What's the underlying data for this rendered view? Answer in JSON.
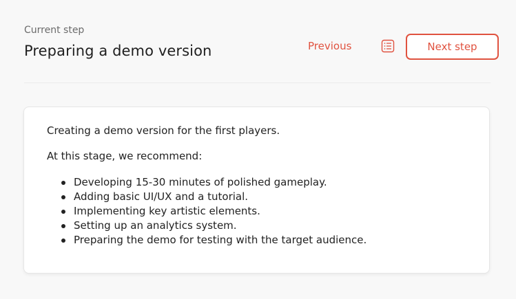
{
  "header": {
    "step_label": "Current step",
    "step_title": "Preparing a demo version",
    "previous_label": "Previous",
    "next_label": "Next step",
    "list_icon": "list-icon"
  },
  "card": {
    "intro": "Creating a demo version for the first players.",
    "recommend": "At this stage, we recommend:",
    "items": [
      "Developing 15-30 minutes of polished gameplay.",
      "Adding basic UI/UX and a tutorial.",
      "Implementing key artistic elements.",
      "Setting up an analytics system.",
      "Preparing the demo for testing with the target audience."
    ]
  },
  "colors": {
    "accent": "#e0523f",
    "background": "#f8f8f8",
    "card": "#ffffff"
  }
}
